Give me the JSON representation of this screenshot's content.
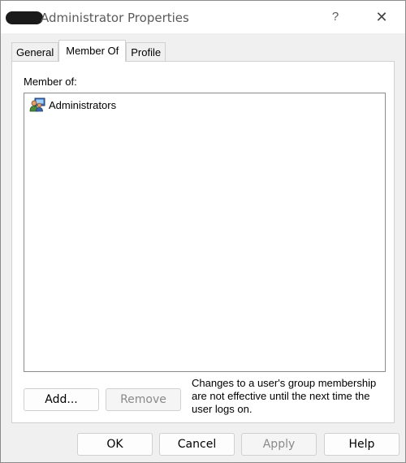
{
  "window": {
    "title": "Administrator Properties",
    "help_glyph": "?",
    "close_glyph": "✕"
  },
  "tabs": [
    {
      "label": "General"
    },
    {
      "label": "Member Of",
      "active": true
    },
    {
      "label": "Profile"
    }
  ],
  "member_of": {
    "label": "Member of:",
    "items": [
      {
        "name": "Administrators",
        "icon": "group-icon"
      }
    ]
  },
  "actions": {
    "add_label": "Add...",
    "remove_label": "Remove",
    "remove_enabled": false
  },
  "note": "Changes to a user's group membership are not effective until the next time the user logs on.",
  "footer": {
    "ok_label": "OK",
    "cancel_label": "Cancel",
    "apply_label": "Apply",
    "apply_enabled": false,
    "help_label": "Help"
  }
}
